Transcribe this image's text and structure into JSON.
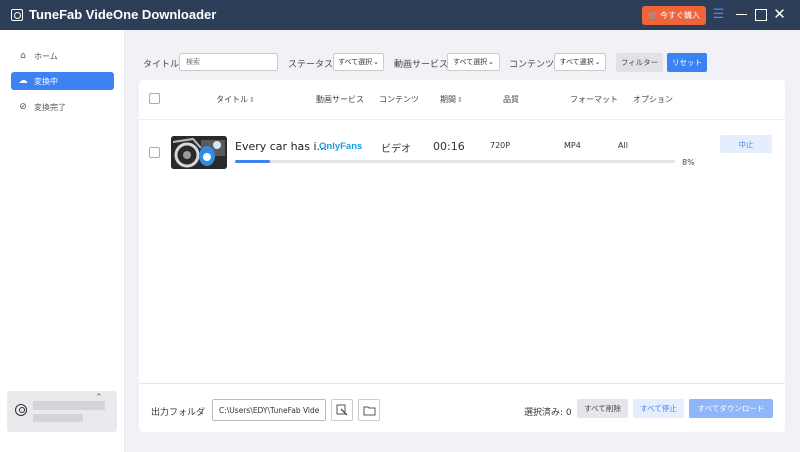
{
  "app": {
    "title": "TuneFab VideOne Downloader",
    "buy_label": "今すぐ購入",
    "colors": {
      "titlebar": "#2c3e58",
      "accent": "#3d82f5",
      "buy": "#f0643c"
    }
  },
  "sidebar": {
    "items": [
      {
        "label": "ホーム",
        "icon": "home-icon"
      },
      {
        "label": "変換中",
        "icon": "cloud-download-icon"
      },
      {
        "label": "変換完了",
        "icon": "check-circle-icon"
      }
    ],
    "active_index": 1
  },
  "filters": {
    "title_label": "タイトル",
    "search_placeholder": "検索",
    "status_label": "ステータス",
    "status_value": "すべて選択",
    "service_label": "動画サービス",
    "service_value": "すべて選択",
    "content_label": "コンテンツ",
    "content_value": "すべて選択",
    "filter_button": "フィルター",
    "reset_button": "リセット"
  },
  "table": {
    "headers": {
      "title": "タイトル",
      "service": "動画サービス",
      "content": "コンテンツ",
      "duration": "期間",
      "quality": "品質",
      "format": "フォーマット",
      "option": "オプション"
    },
    "rows": [
      {
        "title": "Every car has i...",
        "service": "OnlyFans",
        "content": "ビデオ",
        "duration": "00:16",
        "quality": "720P",
        "format": "MP4",
        "option": "All",
        "progress_text": "8%",
        "progress": 0.08,
        "action": "中止"
      }
    ]
  },
  "footer": {
    "output_label": "出力フォルダ",
    "output_path": "C:\\Users\\EDY\\TuneFab Vide",
    "selected_text": "選択済み: 0",
    "delete_all": "すべて削除",
    "stop_all": "すべて停止",
    "download_all": "すべてダウンロード"
  }
}
